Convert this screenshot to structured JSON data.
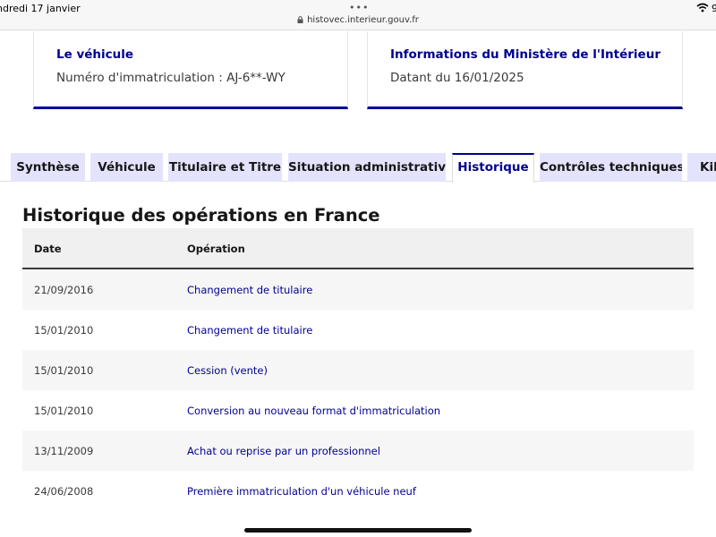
{
  "status_bar": {
    "date": "ndredi 17 janvier",
    "menu_dots": "•••",
    "url": "histovec.interieur.gouv.fr",
    "right_fragment": "9"
  },
  "cards": {
    "vehicle": {
      "title": "Le véhicule",
      "text": "Numéro d'immatriculation : AJ-6**-WY"
    },
    "ministry": {
      "title": "Informations du Ministère de l'Intérieur",
      "text": "Datant du 16/01/2025"
    }
  },
  "tabs": [
    {
      "label": "Synthèse",
      "active": false
    },
    {
      "label": "Véhicule",
      "active": false
    },
    {
      "label": "Titulaire et Titre",
      "active": false
    },
    {
      "label": "Situation administrative",
      "active": false
    },
    {
      "label": "Historique",
      "active": true
    },
    {
      "label": "Contrôles techniques",
      "active": false
    },
    {
      "label": "Kil",
      "active": false
    }
  ],
  "history": {
    "title": "Historique des opérations en France",
    "columns": [
      "Date",
      "Opération"
    ],
    "rows": [
      {
        "date": "21/09/2016",
        "operation": "Changement de titulaire"
      },
      {
        "date": "15/01/2010",
        "operation": "Changement de titulaire"
      },
      {
        "date": "15/01/2010",
        "operation": "Cession (vente)"
      },
      {
        "date": "15/01/2010",
        "operation": "Conversion au nouveau format d'immatriculation"
      },
      {
        "date": "13/11/2009",
        "operation": "Achat ou reprise par un professionnel"
      },
      {
        "date": "24/06/2008",
        "operation": "Première immatriculation d'un véhicule neuf"
      }
    ]
  },
  "colors": {
    "accent": "#000091",
    "tab_background": "#e3e3fd",
    "row_stripe": "#f6f6f6"
  },
  "icons": {
    "url_lock": "lock-icon",
    "wifi": "wifi-icon"
  }
}
